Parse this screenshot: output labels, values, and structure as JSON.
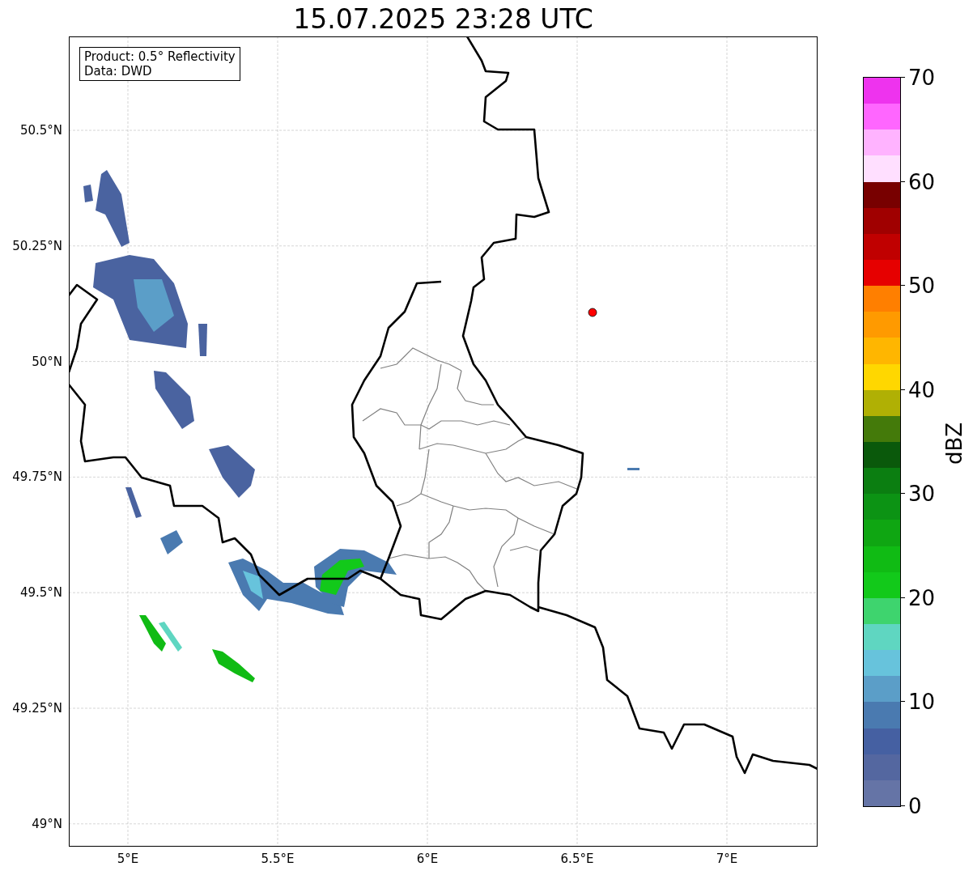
{
  "title": "15.07.2025 23:28 UTC",
  "map": {
    "info_box": [
      "Product: 0.5° Reflectivity",
      "Data: DWD"
    ],
    "lat_ticks": [
      "50.5°N",
      "50.25°N",
      "50°N",
      "49.75°N",
      "49.5°N",
      "49.25°N",
      "49°N"
    ],
    "lon_ticks": [
      "5°E",
      "5.5°E",
      "6°E",
      "6.5°E",
      "7°E"
    ]
  },
  "colorbar": {
    "label": "dBZ",
    "ticks": [
      "70",
      "60",
      "50",
      "40",
      "30",
      "20",
      "10",
      "0"
    ],
    "segments": [
      {
        "color": "#6574a6"
      },
      {
        "color": "#5467a0"
      },
      {
        "color": "#4560a2"
      },
      {
        "color": "#4a7ab0"
      },
      {
        "color": "#5b9ec8"
      },
      {
        "color": "#67c3dc"
      },
      {
        "color": "#5fd6c1"
      },
      {
        "color": "#3ed46e"
      },
      {
        "color": "#12c91a"
      },
      {
        "color": "#10bb14"
      },
      {
        "color": "#0fa612"
      },
      {
        "color": "#0c9314"
      },
      {
        "color": "#0b7e11"
      },
      {
        "color": "#0a590b"
      },
      {
        "color": "#447a0a"
      },
      {
        "color": "#b0b004"
      },
      {
        "color": "#ffd700"
      },
      {
        "color": "#ffb600"
      },
      {
        "color": "#ff9a00"
      },
      {
        "color": "#ff7f00"
      },
      {
        "color": "#e60000"
      },
      {
        "color": "#c00000"
      },
      {
        "color": "#a00000"
      },
      {
        "color": "#780000"
      },
      {
        "color": "#ffdfff"
      },
      {
        "color": "#ffb3ff"
      },
      {
        "color": "#ff66ff"
      },
      {
        "color": "#ee33ee"
      }
    ]
  }
}
